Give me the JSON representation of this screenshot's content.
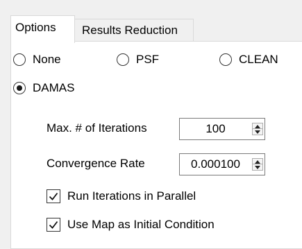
{
  "tabs": [
    {
      "label": "Options",
      "active": true
    },
    {
      "label": "Results Reduction",
      "active": false
    }
  ],
  "method": {
    "options": [
      {
        "label": "None",
        "selected": false
      },
      {
        "label": "PSF",
        "selected": false
      },
      {
        "label": "CLEAN",
        "selected": false
      },
      {
        "label": "DAMAS",
        "selected": true
      }
    ]
  },
  "damas": {
    "max_iterations": {
      "label": "Max. # of Iterations",
      "value": "100"
    },
    "convergence_rate": {
      "label": "Convergence Rate",
      "value": "0.000100"
    },
    "run_parallel": {
      "label": "Run Iterations in Parallel",
      "checked": true
    },
    "use_map_initial": {
      "label": "Use Map as Initial Condition",
      "checked": true
    }
  },
  "icons": {
    "spin_up": "up-triangle",
    "spin_down": "down-triangle",
    "checkmark": "check-mark"
  }
}
